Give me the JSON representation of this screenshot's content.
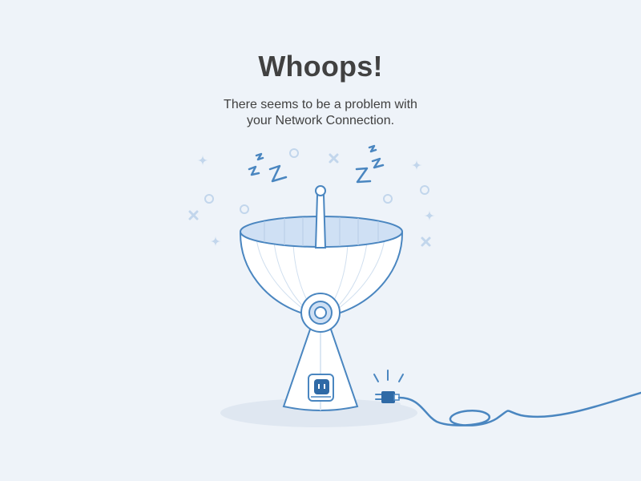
{
  "error": {
    "title": "Whoops!",
    "message_line1": "There seems to be a problem with",
    "message_line2": "your Network Connection."
  },
  "illustration": {
    "subject": "sleeping-satellite-dish-unplugged",
    "icons": [
      "sparkle-icon",
      "circle-icon",
      "cross-icon",
      "sleep-z-icon",
      "antenna-icon",
      "power-socket-icon",
      "power-plug-icon",
      "cable-icon"
    ],
    "colors": {
      "background": "#eef3f9",
      "text": "#414141",
      "stroke": "#4a86c0",
      "fill": "#ffffff",
      "dish_inner": "#cfe0f4",
      "deco": "#c2d6ec",
      "shadow": "#dfe7f1"
    }
  }
}
